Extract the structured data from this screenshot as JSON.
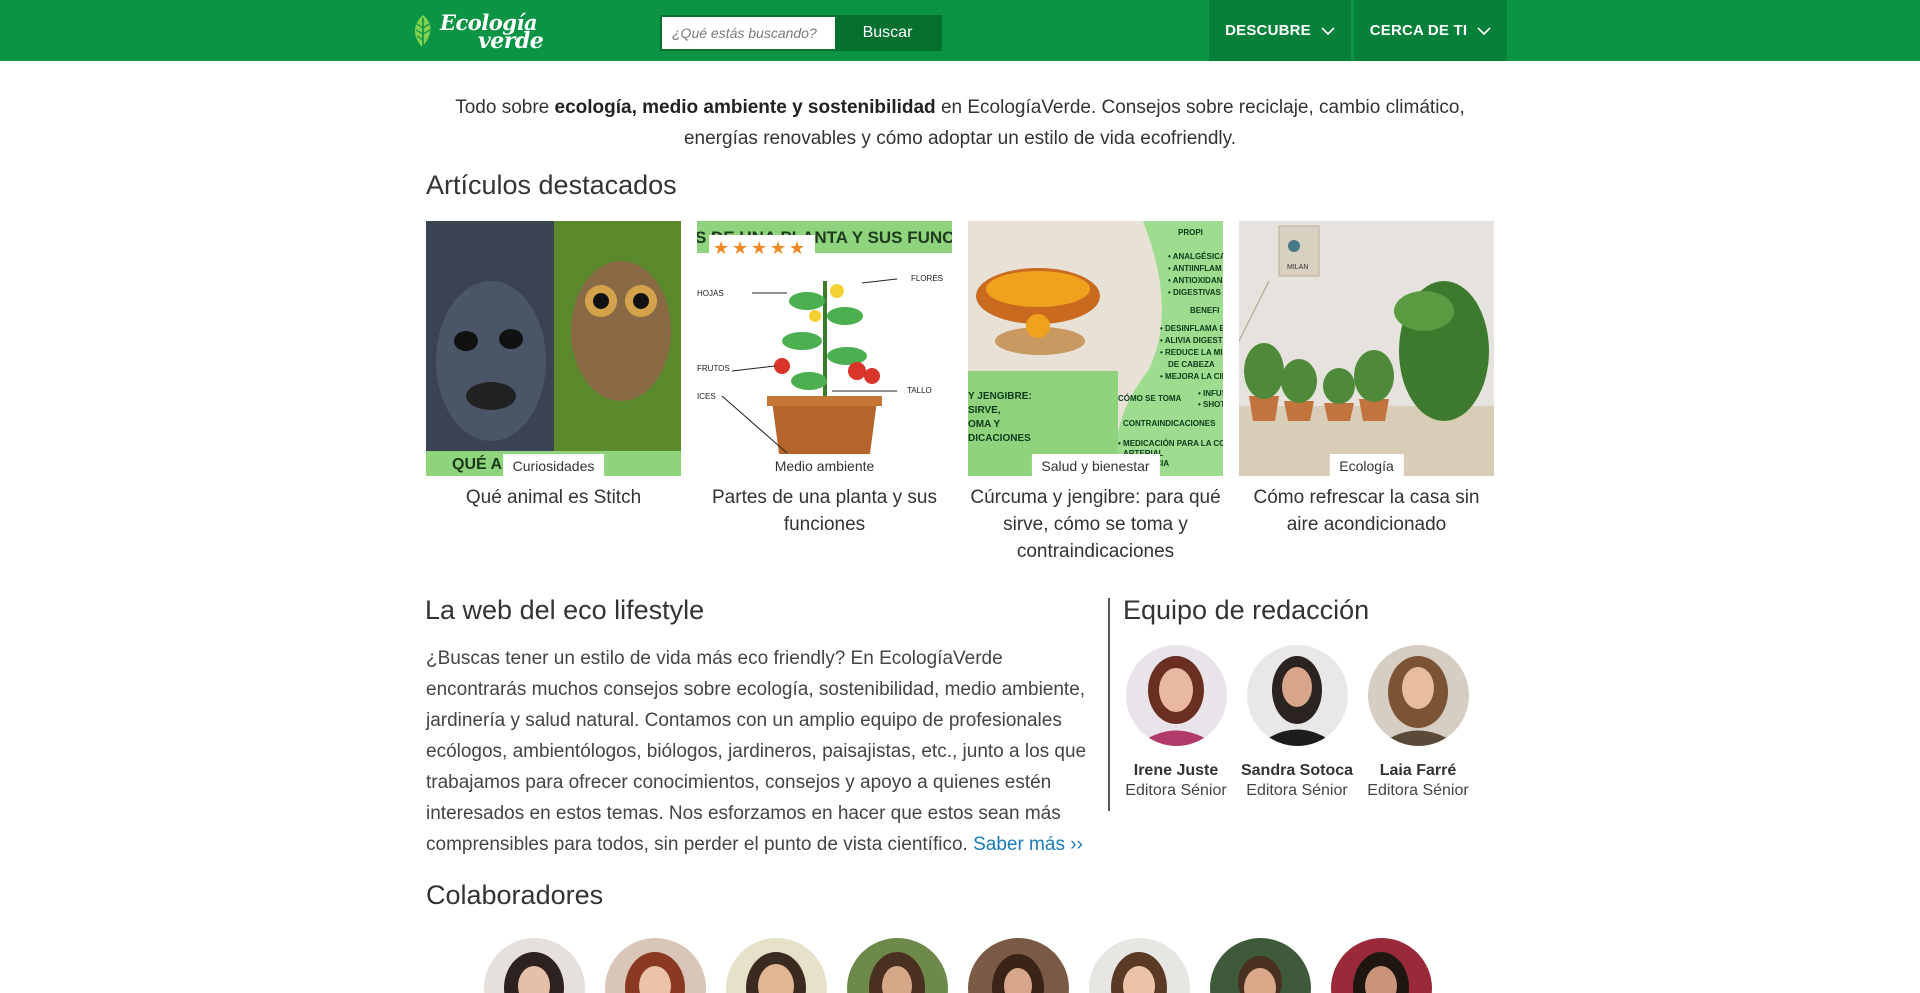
{
  "header": {
    "logo_alt": "EcologíaVerde",
    "search_placeholder": "¿Qué estás buscando?",
    "search_button": "Buscar",
    "nav": [
      {
        "label": "DESCUBRE"
      },
      {
        "label": "CERCA DE TI"
      }
    ]
  },
  "intro": {
    "before": "Todo sobre ",
    "bold": "ecología, medio ambiente y sostenibilidad",
    "after": " en EcologíaVerde. Consejos sobre reciclaje, cambio climático, energías renovables y cómo adoptar un estilo de vida ecofriendly."
  },
  "featured": {
    "title": "Artículos destacados",
    "cards": [
      {
        "tag": "Curiosidades",
        "title": "Qué animal es Stitch",
        "image_text": "QUÉ A"
      },
      {
        "tag": "Medio ambiente",
        "title": "Partes de una planta y sus funciones",
        "image_text": "S DE UNA PLANTA Y SUS FUNC"
      },
      {
        "tag": "Salud y bienestar",
        "title": "Cúrcuma y jengibre: para qué sirve, cómo se toma y contraindicaciones",
        "image_text": "PROPI"
      },
      {
        "tag": "Ecología",
        "title": "Cómo refrescar la casa sin aire acondicionado",
        "image_text": "MILAN"
      }
    ]
  },
  "eco": {
    "title": "La web del eco lifestyle",
    "text": "¿Buscas tener un estilo de vida más eco friendly? En EcologíaVerde encontrarás muchos consejos sobre ecología, sostenibilidad, medio ambiente, jardinería y salud natural. Contamos con un amplio equipo de profesionales ecólogos, ambientólogos, biólogos, jardineros, paisajistas, etc., junto a los que trabajamos para ofrecer conocimientos, consejos y apoyo a quienes estén interesados en estos temas. Nos esforzamos en hacer que estos sean más comprensibles para todos, sin perder el punto de vista científico. ",
    "link": "Saber más ››"
  },
  "team": {
    "title": "Equipo de redacción",
    "members": [
      {
        "name": "Irene Juste",
        "role": "Editora Sénior"
      },
      {
        "name": "Sandra Sotoca",
        "role": "Editora Sénior"
      },
      {
        "name": "Laia Farré",
        "role": "Editora Sénior"
      }
    ]
  },
  "collaborators": {
    "title": "Colaboradores"
  },
  "colors": {
    "brand_green": "#0a9444",
    "nav_dark": "#07813a",
    "button_dark": "#06702f",
    "link_blue": "#1a7bb9"
  }
}
